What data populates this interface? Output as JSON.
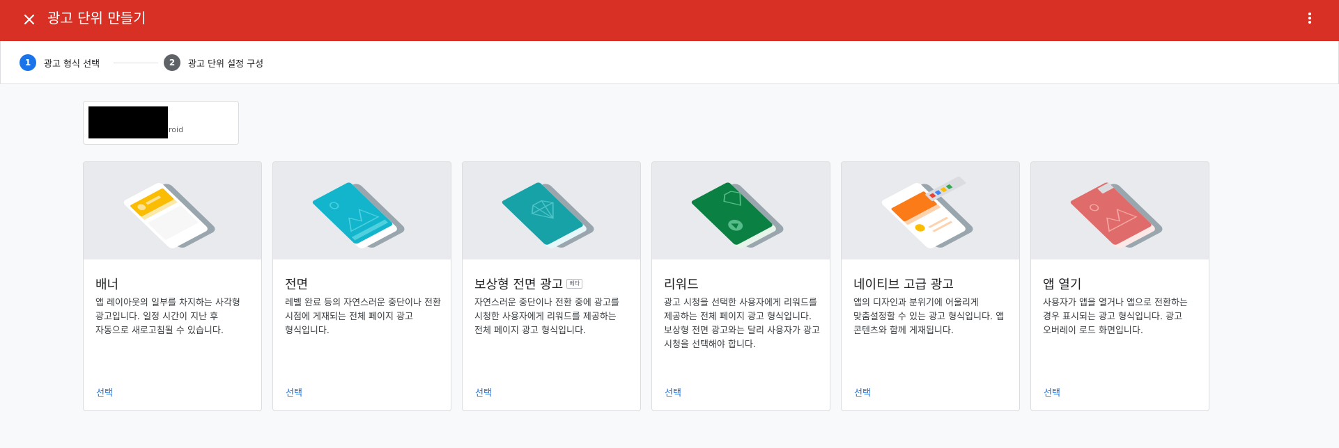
{
  "header": {
    "title": "광고 단위 만들기",
    "colors": {
      "bar": "#d93025"
    },
    "close_icon": "close-icon",
    "more_icon": "more-vert-icon"
  },
  "stepper": {
    "steps": [
      {
        "number": "1",
        "label": "광고 형식 선택",
        "state": "active",
        "color": "#1a73e8"
      },
      {
        "number": "2",
        "label": "광고 단위 설정 구성",
        "state": "inactive",
        "color": "#5f6368"
      }
    ]
  },
  "app": {
    "name_suffix": "roid"
  },
  "formats": [
    {
      "title": "배너",
      "beta": "",
      "description": "앱 레이아웃의 일부를 차지하는 사각형 광고입니다. 일정 시간이 지난 후 자동으로 새로고침될 수 있습니다.",
      "select": "선택",
      "art": "banner"
    },
    {
      "title": "전면",
      "beta": "",
      "description": "레벨 완료 등의 자연스러운 중단이나 전환 시점에 게재되는 전체 페이지 광고 형식입니다.",
      "select": "선택",
      "art": "interstitial"
    },
    {
      "title": "보상형 전면 광고",
      "beta": "베타",
      "description": "자연스러운 중단이나 전환 중에 광고를 시청한 사용자에게 리워드를 제공하는 전체 페이지 광고 형식입니다.",
      "select": "선택",
      "art": "rewarded-interstitial"
    },
    {
      "title": "리워드",
      "beta": "",
      "description": "광고 시청을 선택한 사용자에게 리워드를 제공하는 전체 페이지 광고 형식입니다. 보상형 전면 광고와는 달리 사용자가 광고 시청을 선택해야 합니다.",
      "select": "선택",
      "art": "rewarded"
    },
    {
      "title": "네이티브 고급 광고",
      "beta": "",
      "description": "앱의 디자인과 분위기에 어울리게 맞춤설정할 수 있는 광고 형식입니다. 앱 콘텐츠와 함께 게재됩니다.",
      "select": "선택",
      "art": "native"
    },
    {
      "title": "앱 열기",
      "beta": "",
      "description": "사용자가 앱을 열거나 앱으로 전환하는 경우 표시되는 광고 형식입니다. 광고 오버레이 로드 화면입니다.",
      "select": "선택",
      "art": "app-open"
    }
  ]
}
